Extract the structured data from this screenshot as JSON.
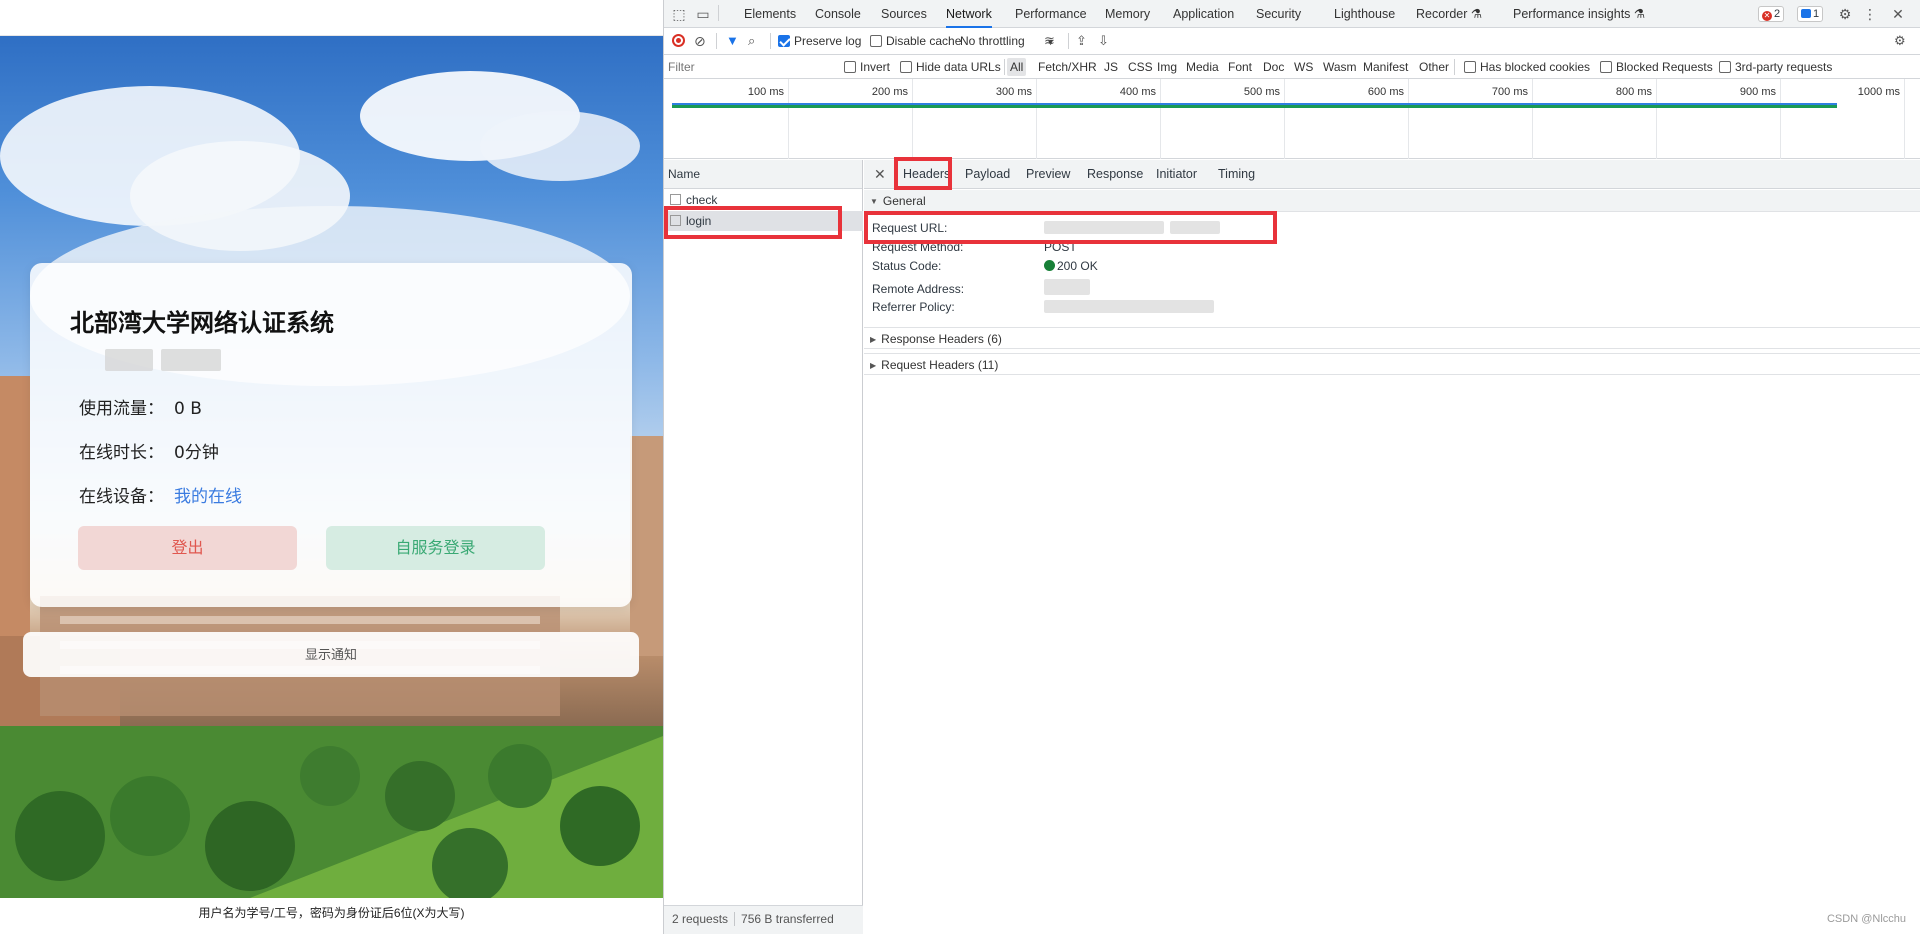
{
  "portal": {
    "title": "北部湾大学网络认证系统",
    "traffic_label": "使用流量：",
    "traffic_value": "0 B",
    "online_time_label": "在线时长：",
    "online_time_value": "0分钟",
    "device_label": "在线设备：",
    "device_link": "我的在线",
    "logout_button": "登出",
    "self_service_button": "自服务登录",
    "notice_button": "显示通知",
    "footer_hint": "用户名为学号/工号，密码为身份证后6位(X为大写)"
  },
  "devtools": {
    "tabs": [
      "Elements",
      "Console",
      "Sources",
      "Network",
      "Performance",
      "Memory",
      "Application",
      "Security",
      "Lighthouse",
      "Recorder",
      "Performance insights"
    ],
    "active_tab": "Network",
    "error_count": "2",
    "message_count": "1",
    "toolbar": {
      "preserve_log": "Preserve log",
      "disable_cache": "Disable cache",
      "throttling": "No throttling"
    },
    "filter": {
      "placeholder": "Filter",
      "invert": "Invert",
      "hide_data_urls": "Hide data URLs",
      "types": [
        "All",
        "Fetch/XHR",
        "JS",
        "CSS",
        "Img",
        "Media",
        "Font",
        "Doc",
        "WS",
        "Wasm",
        "Manifest",
        "Other"
      ],
      "has_blocked_cookies": "Has blocked cookies",
      "blocked_requests": "Blocked Requests",
      "third_party": "3rd-party requests"
    },
    "timeline_ticks": [
      "100 ms",
      "200 ms",
      "300 ms",
      "400 ms",
      "500 ms",
      "600 ms",
      "700 ms",
      "800 ms",
      "900 ms",
      "1000 ms"
    ],
    "name_header": "Name",
    "requests": [
      "check",
      "login"
    ],
    "selected_request": "login",
    "status_bar": {
      "requests": "2 requests",
      "transferred": "756 B transferred"
    },
    "detail_tabs": [
      "Headers",
      "Payload",
      "Preview",
      "Response",
      "Initiator",
      "Timing"
    ],
    "active_detail_tab": "Headers",
    "general_header": "General",
    "general": {
      "request_url_label": "Request URL:",
      "request_method_label": "Request Method:",
      "request_method_value": "POST",
      "status_code_label": "Status Code:",
      "status_code_value": "200 OK",
      "remote_address_label": "Remote Address:",
      "referrer_policy_label": "Referrer Policy:"
    },
    "response_headers": "Response Headers (6)",
    "request_headers": "Request Headers (11)"
  },
  "watermark": "CSDN @Nlcchu",
  "colors": {
    "highlight": "#e8323a",
    "link": "#3a7be0",
    "logout": "#e0574f",
    "self_service": "#3aa974",
    "status_ok": "#188038"
  }
}
